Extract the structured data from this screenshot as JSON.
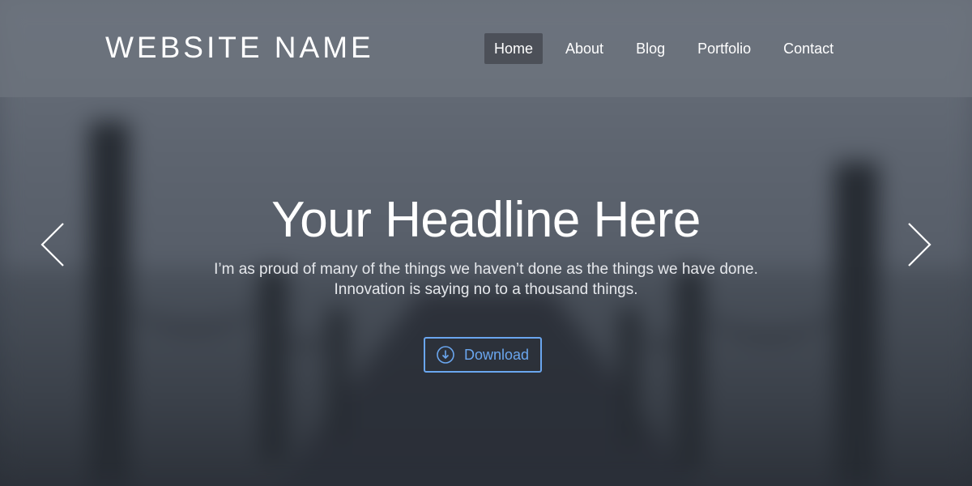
{
  "header": {
    "site_name": "WEBSITE NAME",
    "nav": [
      {
        "label": "Home",
        "active": true
      },
      {
        "label": "About",
        "active": false
      },
      {
        "label": "Blog",
        "active": false
      },
      {
        "label": "Portfolio",
        "active": false
      },
      {
        "label": "Contact",
        "active": false
      }
    ]
  },
  "hero": {
    "headline": "Your Headline Here",
    "subtext_line1": "I’m as proud of many of the things we haven’t done as the things we have done.",
    "subtext_line2": "Innovation is saying no to a thousand things.",
    "download_label": "Download",
    "download_icon": "download-circle-icon",
    "prev_icon": "chevron-left-icon",
    "next_icon": "chevron-right-icon"
  },
  "colors": {
    "accent": "#6aa6ef",
    "text": "#ffffff",
    "active_nav_bg": "#464a52"
  }
}
